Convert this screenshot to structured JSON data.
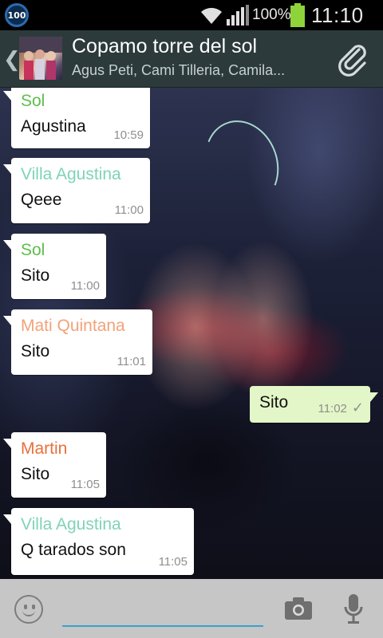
{
  "status_bar": {
    "notification_badge": "100",
    "battery_percent": "100%",
    "time": "11:10"
  },
  "header": {
    "back_icon": "chevron-left-icon",
    "title": "Copamo torre del sol",
    "subtitle": "Agus Peti, Cami Tilleria, Camila...",
    "attach_icon": "paperclip-icon"
  },
  "messages": [
    {
      "sender": "Sol",
      "sender_color": "#5cbf4a",
      "text": "Agustina",
      "time": "10:59",
      "direction": "in"
    },
    {
      "sender": "Villa Agustina",
      "sender_color": "#7fd3b9",
      "text": "Qeee",
      "time": "11:00",
      "direction": "in"
    },
    {
      "sender": "Sol",
      "sender_color": "#5cbf4a",
      "text": "Sito",
      "time": "11:00",
      "direction": "in"
    },
    {
      "sender": "Mati Quintana",
      "sender_color": "#f2a27a",
      "text": "Sito",
      "time": "11:01",
      "direction": "in"
    },
    {
      "sender": "",
      "sender_color": "",
      "text": "Sito",
      "time": "11:02",
      "direction": "out",
      "status": "✓"
    },
    {
      "sender": "Martin",
      "sender_color": "#e8703a",
      "text": "Sito",
      "time": "11:05",
      "direction": "in"
    },
    {
      "sender": "Villa Agustina",
      "sender_color": "#7fd3b9",
      "text": "Q tarados son",
      "time": "11:05",
      "direction": "in"
    }
  ],
  "input_bar": {
    "emoji_icon": "smiley-icon",
    "message_value": "",
    "camera_icon": "camera-icon",
    "mic_icon": "microphone-icon"
  }
}
